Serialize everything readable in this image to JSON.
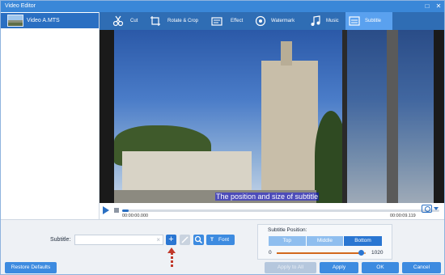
{
  "window": {
    "title": "Video Editor"
  },
  "file_list": [
    {
      "name": "Video A.MTS"
    }
  ],
  "tabs": [
    {
      "label": "Cut",
      "icon": "scissors-icon"
    },
    {
      "label": "Rotate & Crop",
      "icon": "crop-icon"
    },
    {
      "label": "Effect",
      "icon": "effect-icon"
    },
    {
      "label": "Watermark",
      "icon": "watermark-icon"
    },
    {
      "label": "Music",
      "icon": "music-note-icon"
    },
    {
      "label": "Subtitle",
      "icon": "subtitle-icon",
      "active": true
    }
  ],
  "preview": {
    "subtitle_text": "The position and size of subtitle",
    "time_start": "00:00:00.000",
    "time_end": "00:00:09.119",
    "progress": 0.02
  },
  "subtitle": {
    "label": "Subtitle:",
    "input_value": "",
    "font_label": "Font"
  },
  "position": {
    "label": "Subtitle Position:",
    "options": [
      "Top",
      "Middle",
      "Bottom"
    ],
    "selected": "Bottom",
    "slider_min": "0",
    "slider_max": "1020",
    "slider_value": 0.95
  },
  "buttons": {
    "restore": "Restore Defaults",
    "apply_all": "Apply to All",
    "apply": "Apply",
    "ok": "OK",
    "cancel": "Cancel"
  },
  "colors": {
    "titlebar": "#3a87d8",
    "tabbar": "#2f6db4",
    "active_tab": "#5aa1ef",
    "accent": "#2a76d2",
    "annotation_arrow": "#c0392b"
  }
}
